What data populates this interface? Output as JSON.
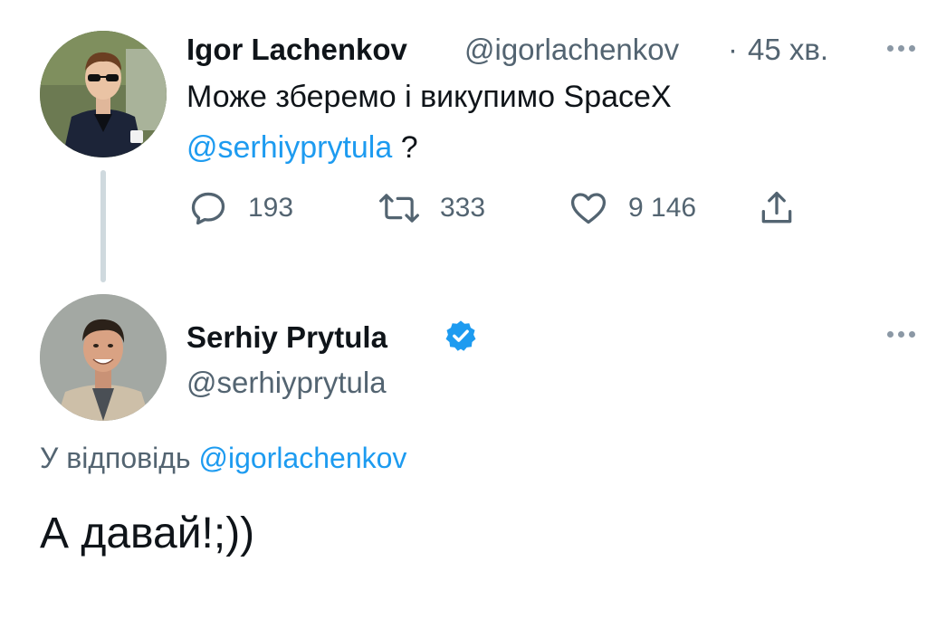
{
  "tweet1": {
    "author_name": "Igor Lachenkov",
    "author_handle": "@igorlachenkov",
    "separator": "·",
    "time": "45 хв.",
    "text_line1": "Може зберемо і викупимо SpaceX",
    "mention": "@serhiyprytula",
    "text_suffix": " ?",
    "actions": {
      "reply_count": "193",
      "retweet_count": "333",
      "like_count": "9 146"
    }
  },
  "tweet2": {
    "author_name": "Serhiy Prytula",
    "author_handle": "@serhiyprytula",
    "verified": true,
    "reply_prefix": "У відповідь ",
    "reply_to_handle": "@igorlachenkov",
    "text": "А давай!;))"
  },
  "colors": {
    "link": "#1d9bf0",
    "secondary_text": "#536471",
    "thread_line": "#cfd9de",
    "verified_badge": "#1d9bf0"
  },
  "icons": [
    "more-icon",
    "reply-icon",
    "retweet-icon",
    "like-icon",
    "share-icon",
    "verified-badge-icon"
  ]
}
